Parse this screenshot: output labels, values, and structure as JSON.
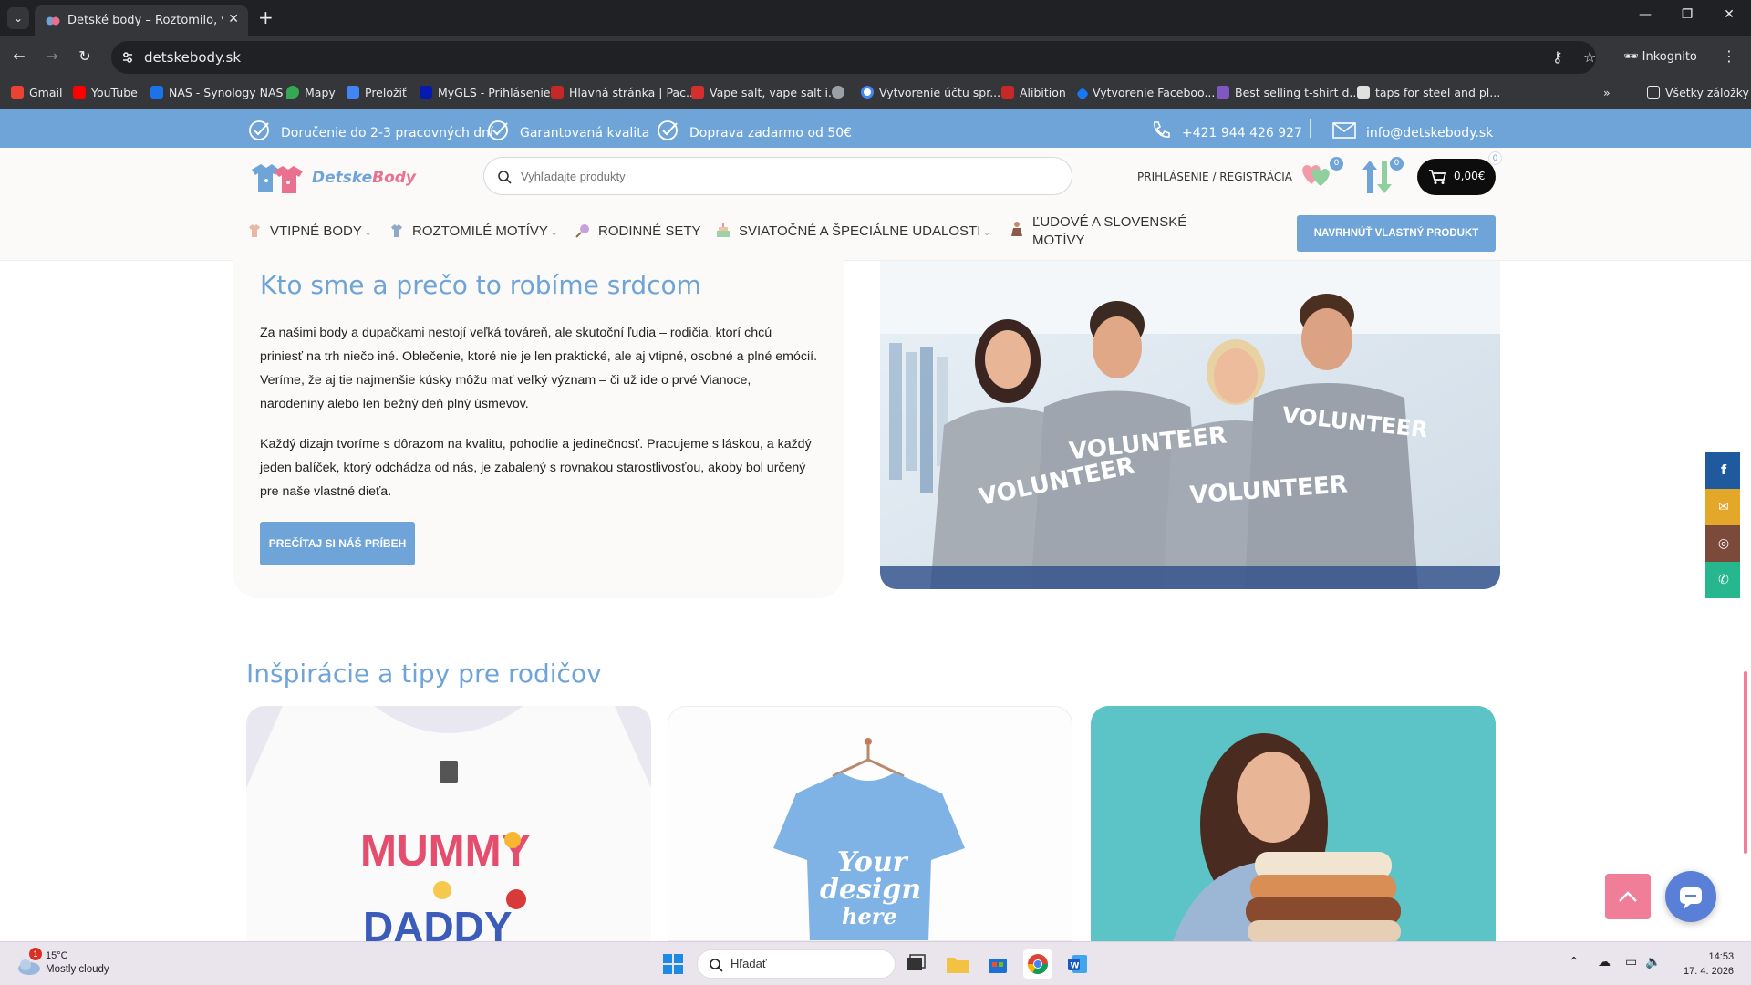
{
  "browser": {
    "tab_title": "Detské body – Roztomilo, vtipn",
    "url": "detskebody.sk",
    "incognito_label": "Inkognito",
    "bookmarks": [
      {
        "label": "Gmail",
        "color": "#ea4335"
      },
      {
        "label": "YouTube",
        "color": "#ff0000"
      },
      {
        "label": "NAS - Synology NAS",
        "color": "#1a73e8"
      },
      {
        "label": "Mapy",
        "color": "#34a853"
      },
      {
        "label": "Preložiť",
        "color": "#4285f4"
      },
      {
        "label": "MyGLS - Prihlásenie",
        "color": "#061ab1"
      },
      {
        "label": "Hlavná stránka | Pac...",
        "color": "#c62828"
      },
      {
        "label": "Vape salt, vape salt i...",
        "color": "#d32f2f"
      },
      {
        "label": "",
        "color": "#9aa0a6"
      },
      {
        "label": "Vytvorenie účtu spr...",
        "color": "#ffffff"
      },
      {
        "label": "Alibition",
        "color": "#c62828"
      },
      {
        "label": "Vytvorenie Faceboo...",
        "color": "#1877f2"
      },
      {
        "label": "Best selling t-shirt d...",
        "color": "#7e57c2"
      },
      {
        "label": "taps for steel and pl...",
        "color": "#e0e0e0"
      }
    ],
    "all_bookmarks_label": "Všetky záložky"
  },
  "promo": {
    "items": [
      "Doručenie do 2-3 pracovných dní",
      "Garantovaná kvalita",
      "Doprava zadarmo od 50€"
    ],
    "phone": "+421 944 426 927",
    "email": "info@detskebody.sk"
  },
  "header": {
    "logo_part1": "Detske",
    "logo_part2": "Body",
    "search_placeholder": "Vyhľadajte produkty",
    "login": "PRIHLÁSENIE / REGISTRÁCIA",
    "wishlist_count": "0",
    "compare_count": "0",
    "cart_total": "0,00€",
    "cart_count": "0"
  },
  "menu": {
    "items": [
      {
        "label": "Vtipné body",
        "has_dropdown": true
      },
      {
        "label": "Roztomilé motívy",
        "has_dropdown": true
      },
      {
        "label": "Rodinné sety",
        "has_dropdown": false
      },
      {
        "label": "Sviatočné a špeciálne udalosti",
        "has_dropdown": true
      },
      {
        "label": "Ľudové a slovenské",
        "label_line2": "motívy",
        "has_dropdown": false
      }
    ],
    "cta": "NAVRHNÚŤ VLASTNÝ PRODUKT"
  },
  "story": {
    "title": "Kto sme a prečo to robíme srdcom",
    "paragraph1": "Za našimi body a dupačkami nestojí veľká továreň, ale skutoční ľudia – rodičia, ktorí chcú priniesť na trh niečo iné. Oblečenie, ktoré nie je len praktické, ale aj vtipné, osobné a plné emócií. Veríme, že aj tie najmenšie kúsky môžu mať veľký význam – či už ide o prvé Vianoce, narodeniny alebo len bežný deň plný úsmevov.",
    "paragraph2": "Každý dizajn tvoríme s dôrazom na kvalitu, pohodlie a jedinečnosť. Pracujeme s láskou, a každý jeden balíček, ktorý odchádza od nás, je zabalený s rovnakou starostlivosťou, akoby bol určený pre naše vlastné dieťa.",
    "button": "PREČÍTAJ SI NÁŠ PRÍBEH",
    "shirt_text": [
      "VOLUNTEER",
      "VOLUNTEER",
      "VOLUNTEER",
      "VOLUNTEER"
    ]
  },
  "social": [
    {
      "name": "facebook",
      "glyph": "f",
      "color": "#1f5a9e"
    },
    {
      "name": "email",
      "glyph": "✉",
      "color": "#e3a72a"
    },
    {
      "name": "instagram",
      "glyph": "◎",
      "color": "#7b4a3a"
    },
    {
      "name": "whatsapp",
      "glyph": "✆",
      "color": "#27b78e"
    }
  ],
  "tips": {
    "title": "Inšpirácie a tipy pre rodičov",
    "card1_text": [
      "MUMMY",
      "DADDY"
    ],
    "card2_text": [
      "Your",
      "design",
      "here"
    ]
  },
  "taskbar": {
    "weather_temp": "15°C",
    "weather_desc": "Mostly cloudy",
    "weather_badge": "1",
    "search_label": "Hľadať",
    "time": "14:53",
    "date": "17. 4. 2026"
  }
}
